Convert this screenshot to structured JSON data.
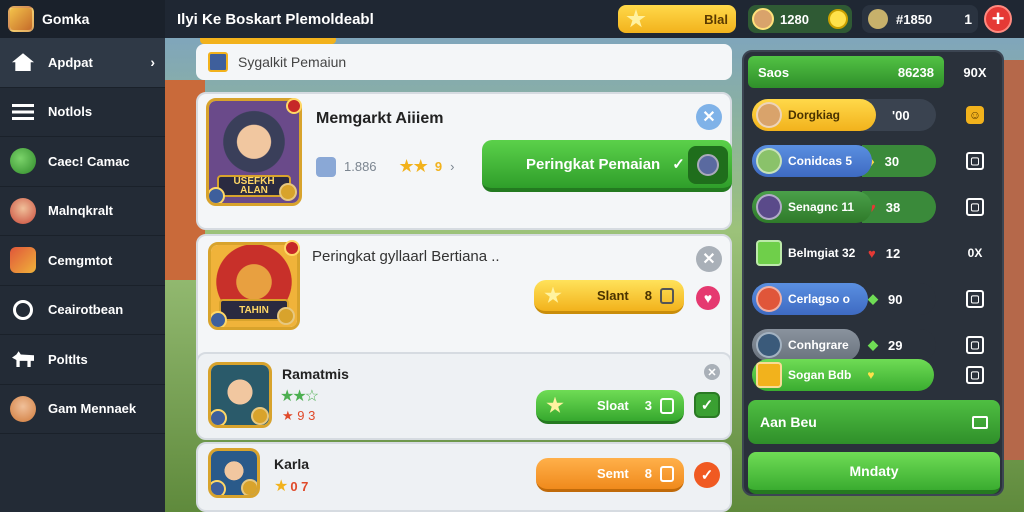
{
  "topbar": {
    "brand": "Gomka",
    "title": "Ilyi Ke Boskart Plemoldeabl",
    "gold_value": "Blal",
    "green_value": "1280",
    "dark_value": "#1850",
    "dark_count": "1",
    "plus": "+"
  },
  "sidebar": {
    "items": [
      {
        "label": "Apdpat",
        "icon": "home-icon",
        "active": true
      },
      {
        "label": "Notlols",
        "icon": "list-icon"
      },
      {
        "label": "Caec! Camac",
        "icon": "character-icon"
      },
      {
        "label": "Malnqkralt",
        "icon": "character-icon"
      },
      {
        "label": "Cemgmtot",
        "icon": "character-icon"
      },
      {
        "label": "Ceairotbean",
        "icon": "user-icon"
      },
      {
        "label": "Poltlts",
        "icon": "dog-icon"
      },
      {
        "label": "Gam Mennaek",
        "icon": "character-icon"
      }
    ]
  },
  "main": {
    "search_placeholder": "Sygalkit Pemaiun",
    "cards": [
      {
        "title": "Memgarkt Aiiiem",
        "nameplate": "USEFKH ALAN",
        "meta_value": "1.886",
        "meta_stars": "★★",
        "meta_num": "9",
        "meta_arrow": "›",
        "button_label": "Peringkat Pemaian",
        "button_check": "✓"
      },
      {
        "title": "Peringkat gyllaarl Bertiana ..",
        "nameplate": "TAHIN",
        "pill_label": "Slant",
        "pill_num": "8"
      },
      {
        "title": "Ramatmis",
        "stars_green": "★★☆",
        "stars_red": "★ 9 3",
        "pill_label": "Sloat",
        "pill_num": "3",
        "check": "✓"
      },
      {
        "title": "Karla",
        "stars_yellow": "★",
        "stars_num": "0 7",
        "pill_label": "Semt",
        "pill_num": "8",
        "check": "✓"
      }
    ]
  },
  "board": {
    "header_label": "Saos",
    "header_value": "86238",
    "header_right": "90X",
    "rows": [
      {
        "name": "Dorgkiag",
        "value": "'00",
        "end": "☺",
        "color": "#f2b21c"
      },
      {
        "name": "Conidcas 5",
        "value": "30",
        "end": "▢",
        "color": "#3e7ac2"
      },
      {
        "name": "Senagnc 11",
        "value": "38",
        "end": "▢",
        "color": "#3a8a3a"
      },
      {
        "name": "Belmgiat 32",
        "value": "12",
        "end": "0X",
        "color": "none"
      },
      {
        "name": "Cerlagso o",
        "value": "90",
        "end": "▢",
        "color": "#3e7ac2"
      },
      {
        "name": "Conhgrare",
        "value": "29",
        "end": "▢",
        "color": "#7b8590"
      },
      {
        "name": "Sogan Bdb",
        "value": "",
        "end": "▢",
        "color": "#4fbf42"
      }
    ],
    "banner_label": "Aan Beu",
    "button_label": "Mndaty"
  },
  "colors": {
    "accent_green": "#3aa032",
    "accent_yellow": "#f2b21c",
    "accent_red": "#e53935",
    "sidebar_bg": "#232b36"
  }
}
